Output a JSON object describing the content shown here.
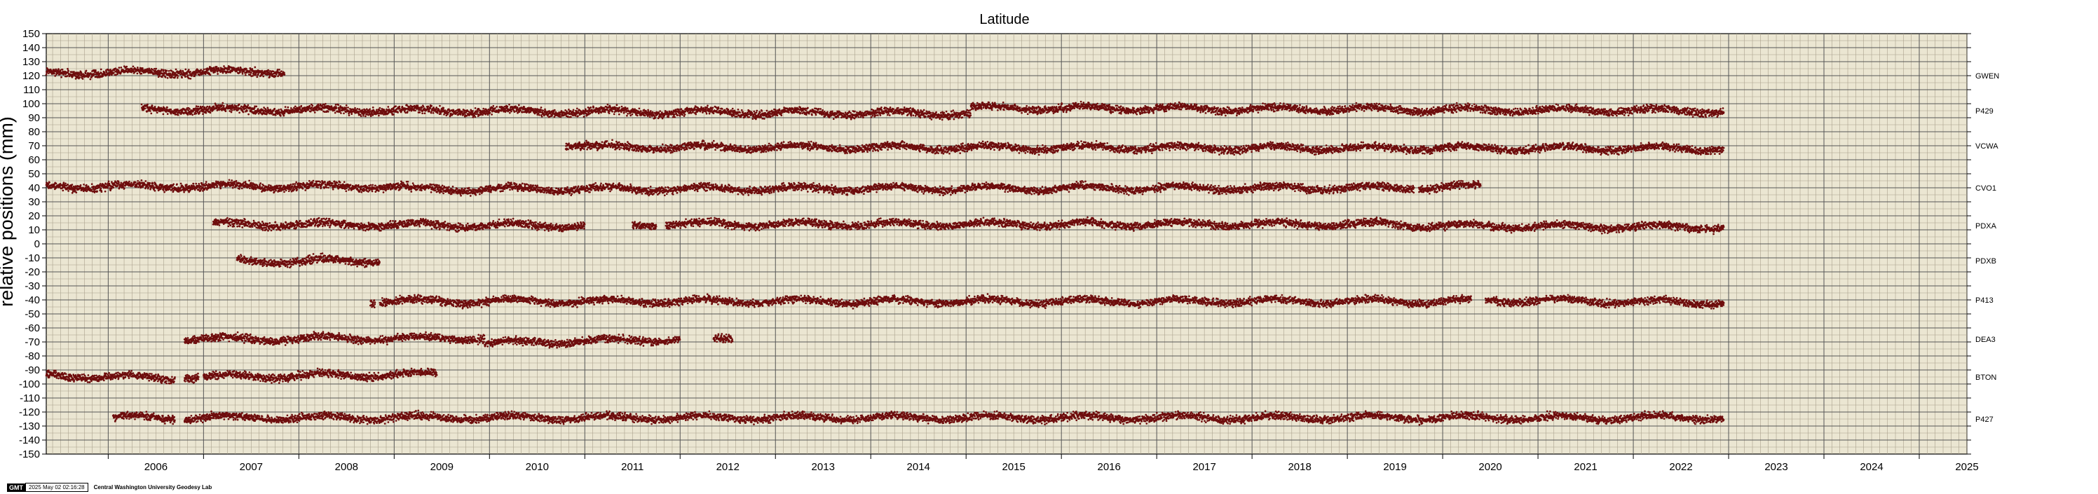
{
  "chart_data": {
    "type": "scatter",
    "title": "Latitude",
    "ylabel": "relative positions (mm)",
    "xlabel": "",
    "xlim": [
      2005.35,
      2025.5
    ],
    "ylim": [
      -150,
      150
    ],
    "x_ticks": [
      "2006",
      "2007",
      "2008",
      "2009",
      "2010",
      "2011",
      "2012",
      "2013",
      "2014",
      "2015",
      "2016",
      "2017",
      "2018",
      "2019",
      "2020",
      "2021",
      "2022",
      "2023",
      "2024",
      "2025"
    ],
    "y_ticks": [
      "150",
      "140",
      "130",
      "120",
      "110",
      "100",
      "90",
      "80",
      "70",
      "60",
      "50",
      "40",
      "30",
      "20",
      "10",
      "0",
      "-10",
      "-20",
      "-30",
      "-40",
      "-50",
      "-60",
      "-70",
      "-80",
      "-90",
      "-100",
      "-110",
      "-120",
      "-130",
      "-140",
      "-150"
    ],
    "grid": true,
    "point_color": "#6e0d0d",
    "background_color": "#ebe6d2",
    "series": [
      {
        "name": "GWEN",
        "offset": 120,
        "segments": [
          {
            "start": 2005.35,
            "end": 2007.85,
            "y_start": 122,
            "y_end": 123
          }
        ]
      },
      {
        "name": "P429",
        "offset": 95,
        "segments": [
          {
            "start": 2006.35,
            "end": 2015.05,
            "y_start": 96,
            "y_end": 93
          },
          {
            "start": 2015.05,
            "end": 2022.95,
            "y_start": 97,
            "y_end": 95
          }
        ]
      },
      {
        "name": "VCWA",
        "offset": 70,
        "segments": [
          {
            "start": 2010.8,
            "end": 2011.05,
            "y_start": 71,
            "y_end": 70
          },
          {
            "start": 2011.05,
            "end": 2022.95,
            "y_start": 69,
            "y_end": 68
          }
        ]
      },
      {
        "name": "CVO1",
        "offset": 40,
        "segments": [
          {
            "start": 2005.35,
            "end": 2009.15,
            "y_start": 41,
            "y_end": 41
          },
          {
            "start": 2009.15,
            "end": 2019.7,
            "y_start": 39,
            "y_end": 40
          },
          {
            "start": 2019.75,
            "end": 2020.4,
            "y_start": 40,
            "y_end": 41
          }
        ]
      },
      {
        "name": "PDXA",
        "offset": 13,
        "segments": [
          {
            "start": 2007.1,
            "end": 2011.0,
            "y_start": 14,
            "y_end": 13
          },
          {
            "start": 2011.5,
            "end": 2011.75,
            "y_start": 14,
            "y_end": 14
          },
          {
            "start": 2011.85,
            "end": 2019.65,
            "y_start": 14,
            "y_end": 14
          },
          {
            "start": 2019.65,
            "end": 2022.95,
            "y_start": 13,
            "y_end": 12
          }
        ]
      },
      {
        "name": "PDXB",
        "offset": -12,
        "segments": [
          {
            "start": 2007.35,
            "end": 2008.1,
            "y_start": -12,
            "y_end": -13
          },
          {
            "start": 2008.1,
            "end": 2008.85,
            "y_start": -12,
            "y_end": -12
          }
        ]
      },
      {
        "name": "P413",
        "offset": -40,
        "segments": [
          {
            "start": 2008.75,
            "end": 2008.8,
            "y_start": -41,
            "y_end": -41
          },
          {
            "start": 2008.85,
            "end": 2020.3,
            "y_start": -41,
            "y_end": -41
          },
          {
            "start": 2020.45,
            "end": 2022.95,
            "y_start": -40,
            "y_end": -42
          }
        ]
      },
      {
        "name": "DEA3",
        "offset": -68,
        "segments": [
          {
            "start": 2006.8,
            "end": 2009.95,
            "y_start": -68,
            "y_end": -67
          },
          {
            "start": 2009.95,
            "end": 2012.0,
            "y_start": -71,
            "y_end": -68
          },
          {
            "start": 2012.35,
            "end": 2012.55,
            "y_start": -68,
            "y_end": -68
          }
        ]
      },
      {
        "name": "BTON",
        "offset": -95,
        "segments": [
          {
            "start": 2005.35,
            "end": 2006.7,
            "y_start": -94,
            "y_end": -96
          },
          {
            "start": 2006.8,
            "end": 2006.95,
            "y_start": -95,
            "y_end": -95
          },
          {
            "start": 2007.0,
            "end": 2009.45,
            "y_start": -95,
            "y_end": -93
          }
        ]
      },
      {
        "name": "P427",
        "offset": -125,
        "segments": [
          {
            "start": 2006.05,
            "end": 2006.7,
            "y_start": -124,
            "y_end": -124
          },
          {
            "start": 2006.8,
            "end": 2022.95,
            "y_start": -124,
            "y_end": -124
          }
        ]
      }
    ]
  },
  "footer": {
    "logo": "GMT",
    "timestamp": "2025 May 02 02:16:28",
    "credit": "Central Washington University Geodesy Lab"
  }
}
